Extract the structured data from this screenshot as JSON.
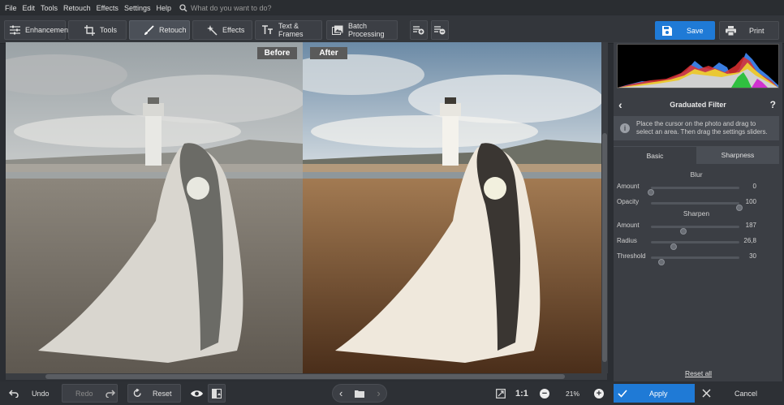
{
  "menu": [
    "File",
    "Edit",
    "Tools",
    "Retouch",
    "Effects",
    "Settings",
    "Help"
  ],
  "search_placeholder": "What do you want to do?",
  "tabs": [
    {
      "label": "Enhancement",
      "icon": "sliders-icon"
    },
    {
      "label": "Tools",
      "icon": "crop-icon"
    },
    {
      "label": "Retouch",
      "icon": "brush-icon"
    },
    {
      "label": "Effects",
      "icon": "sparkle-icon"
    },
    {
      "label": "Text & Frames",
      "icon": "text-icon"
    },
    {
      "label": "Batch Processing",
      "icon": "images-icon"
    }
  ],
  "active_tab": "Retouch",
  "save_label": "Save",
  "print_label": "Print",
  "compare": {
    "before": "Before",
    "after": "After"
  },
  "panel": {
    "title": "Graduated Filter",
    "help": "?",
    "info": "Place the cursor on the photo and drag to select an area. Then drag the settings sliders.",
    "subtabs": [
      "Basic",
      "Sharpness"
    ],
    "active_subtab": "Sharpness",
    "blur_title": "Blur",
    "blur": [
      {
        "label": "Amount",
        "value": "0",
        "level": 0
      },
      {
        "label": "Opacity",
        "value": "100",
        "level": 1.0
      }
    ],
    "sharpen_title": "Sharpen",
    "sharpen": [
      {
        "label": "Amount",
        "value": "187",
        "level": 0.37
      },
      {
        "label": "Radius",
        "value": "26,8",
        "level": 0.26
      },
      {
        "label": "Threshold",
        "value": "30",
        "level": 0.12
      }
    ],
    "reset_all": "Reset all"
  },
  "bottom": {
    "undo": "Undo",
    "redo": "Redo",
    "reset": "Reset",
    "zoom_ratio": "1:1",
    "zoom": "21%",
    "apply": "Apply",
    "cancel": "Cancel"
  },
  "colors": {
    "accent": "#1f7ad6",
    "panel": "#3b3e44",
    "toolbar": "#33363b"
  }
}
